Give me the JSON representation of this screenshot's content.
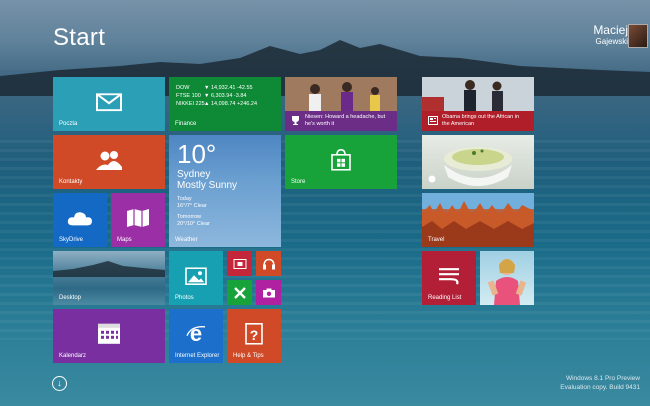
{
  "start": {
    "title": "Start"
  },
  "user": {
    "name": "Maciej",
    "surname": "Gajewski"
  },
  "tiles": {
    "mail": {
      "label": "Poczta",
      "color": "#2a9fb6"
    },
    "finance": {
      "label": "Finance",
      "color": "#0e8a36",
      "rows": [
        {
          "index": "DOW",
          "value": "▼ 14,932.41 -42.55"
        },
        {
          "index": "FTSE 100",
          "value": "▼ 6,303.94 -3.84"
        },
        {
          "index": "NIKKEI 225",
          "value": "▲ 14,098.74 +246.24"
        }
      ]
    },
    "sports": {
      "headline": "Niesen: Howard a headache, but he's worth it"
    },
    "news": {
      "headline": "Obama brings out the African in the American"
    },
    "contacts": {
      "label": "Kontakty",
      "color": "#d04a27"
    },
    "weather": {
      "label": "Weather",
      "temp": "10°",
      "city": "Sydney",
      "condition": "Mostly Sunny",
      "today_label": "Today",
      "today_value": "16°/7° Clear",
      "tomorrow_label": "Tomorrow",
      "tomorrow_value": "20°/10° Clear"
    },
    "store": {
      "label": "Store",
      "color": "#17a33a"
    },
    "skydrive": {
      "label": "SkyDrive",
      "color": "#1469c5"
    },
    "maps": {
      "label": "Maps",
      "color": "#9b2fa6"
    },
    "desktop": {
      "label": "Desktop"
    },
    "photos": {
      "label": "Photos",
      "color": "#16a0b2"
    },
    "travel": {
      "label": "Travel"
    },
    "reading_list": {
      "label": "Reading List",
      "color": "#b21f37"
    },
    "calendar": {
      "label": "Kalendarz",
      "color": "#7a2fa0"
    },
    "ie": {
      "label": "Internet Explorer",
      "color": "#1d6fcc"
    },
    "help": {
      "label": "Help & Tips",
      "color": "#d04a27"
    }
  },
  "watermark": {
    "line1": "Windows 8.1 Pro Preview",
    "line2": "Evaluation copy. Build 9431"
  },
  "icons": {
    "mail": "envelope-icon",
    "contacts": "people-icon",
    "store": "shopping-bag-icon",
    "skydrive": "cloud-icon",
    "maps": "map-icon",
    "photos": "picture-icon",
    "calendar": "calendar-icon",
    "ie": "internet-explorer-icon",
    "help": "question-icon",
    "video": "video-icon",
    "music": "headphones-icon",
    "games": "xbox-icon",
    "camera": "camera-icon",
    "down": "down-arrow-icon"
  }
}
